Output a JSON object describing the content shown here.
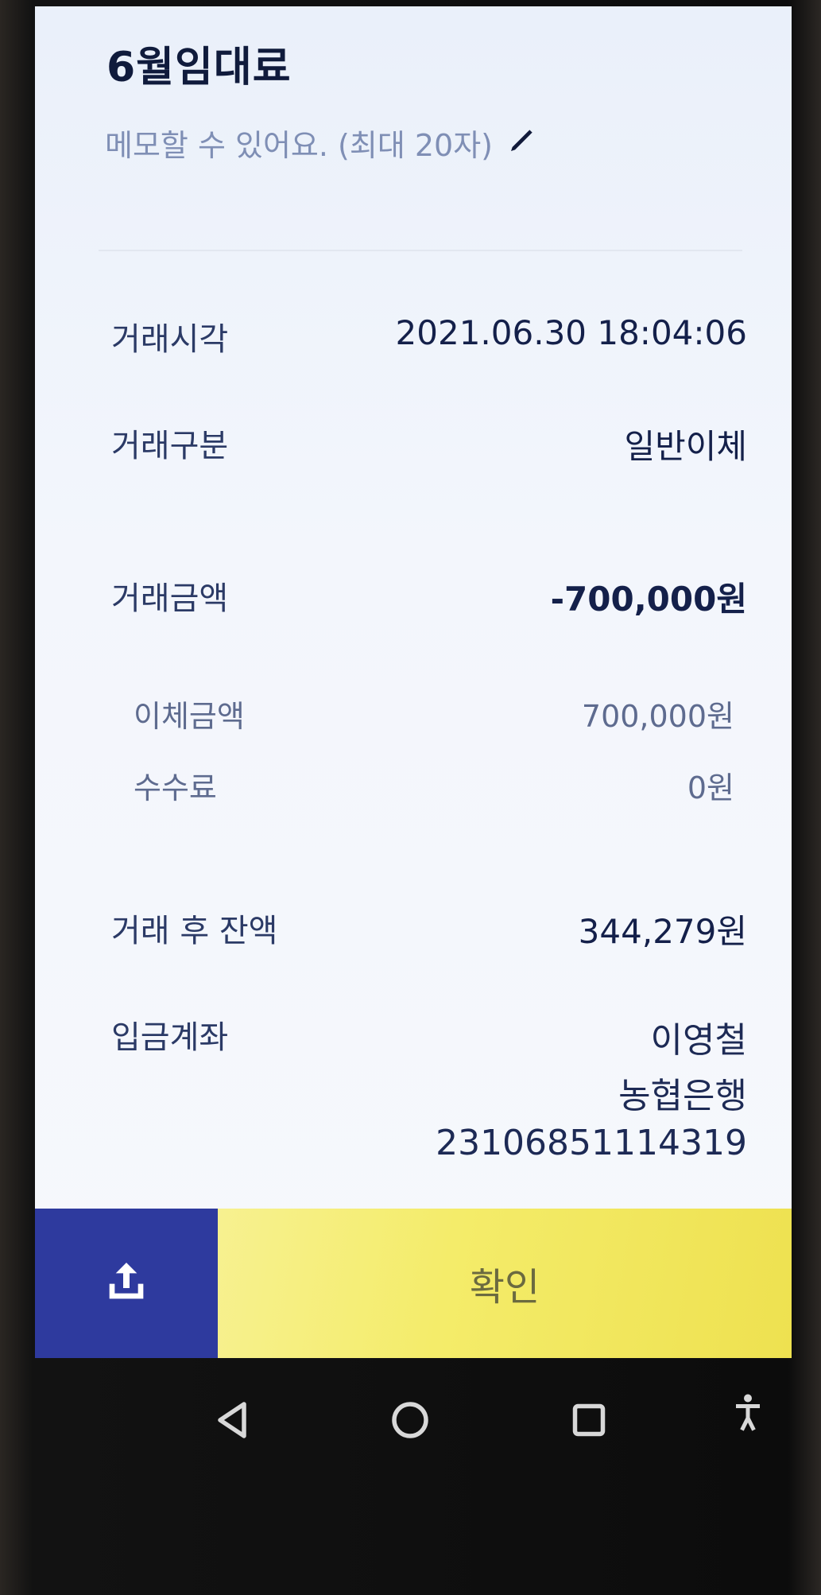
{
  "header": {
    "title": "6월임대료",
    "memo_placeholder": "메모할 수 있어요. (최대 20자)",
    "memo_icon": "pencil-icon"
  },
  "details": {
    "time_label": "거래시각",
    "time_value": "2021.06.30 18:04:06",
    "type_label": "거래구분",
    "type_value": "일반이체",
    "amount_label": "거래금액",
    "amount_value": "-700,000원",
    "transfer_label": "이체금액",
    "transfer_value": "700,000원",
    "fee_label": "수수료",
    "fee_value": "0원",
    "balance_label": "거래 후 잔액",
    "balance_value": "344,279원",
    "account_label": "입금계좌",
    "account_name": "이영철",
    "account_bank": "농협은행",
    "account_number": "23106851114319"
  },
  "bottom": {
    "share_icon": "share-icon",
    "confirm_label": "확인"
  },
  "navbar": {
    "back_icon": "back-triangle-icon",
    "home_icon": "home-circle-icon",
    "recents_icon": "recents-square-icon",
    "accessibility_icon": "accessibility-icon"
  },
  "colors": {
    "accent_blue": "#2e3a9e",
    "confirm_yellow": "#f4ec6a",
    "text_dark": "#14204a",
    "memo_text": "#7f8fb5"
  }
}
